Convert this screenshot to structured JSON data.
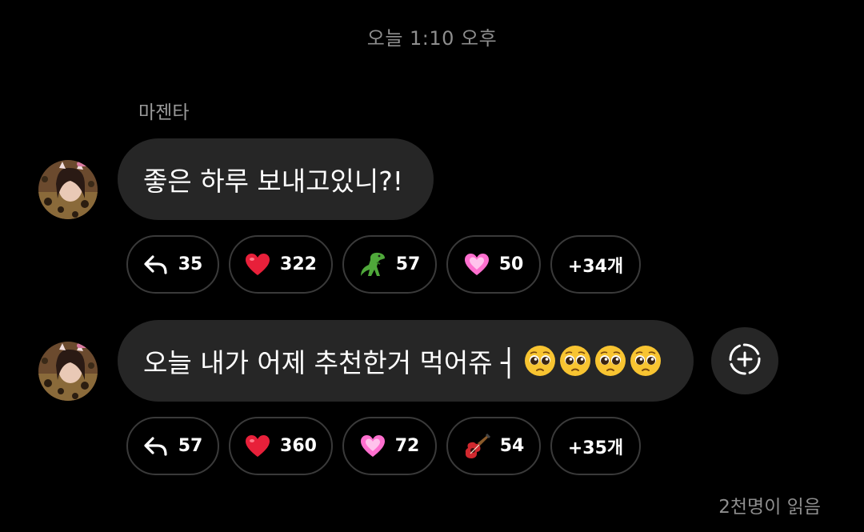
{
  "timestamp": "오늘 1:10 오후",
  "sender_name": "마젠타",
  "messages": [
    {
      "text": "좋은 하루 보내고있니?!",
      "reactions": [
        {
          "icon": "reply-arrow-icon",
          "count": "35"
        },
        {
          "icon": "red-heart-icon",
          "count": "322"
        },
        {
          "icon": "t-rex-icon",
          "count": "57"
        },
        {
          "icon": "pink-heart-icon",
          "count": "50"
        },
        {
          "label": "+34개"
        }
      ]
    },
    {
      "text": "오늘 내가 어제 추천한거 먹어쥬 ┤",
      "emoji_icon": "pleading-face-icon",
      "emoji_count": 4,
      "reactions": [
        {
          "icon": "reply-arrow-icon",
          "count": "57"
        },
        {
          "icon": "red-heart-icon",
          "count": "360"
        },
        {
          "icon": "pink-heart-icon",
          "count": "72"
        },
        {
          "icon": "guitar-icon",
          "count": "54"
        },
        {
          "label": "+35개"
        }
      ]
    }
  ],
  "read_count": "2천명이 읽음",
  "colors": {
    "background": "#000000",
    "bubble": "#262626",
    "chip_border": "#3a3a3a",
    "muted_text": "#8e8e8e",
    "heart_red": "#e8203a",
    "heart_pink": "#ff6fcf"
  }
}
